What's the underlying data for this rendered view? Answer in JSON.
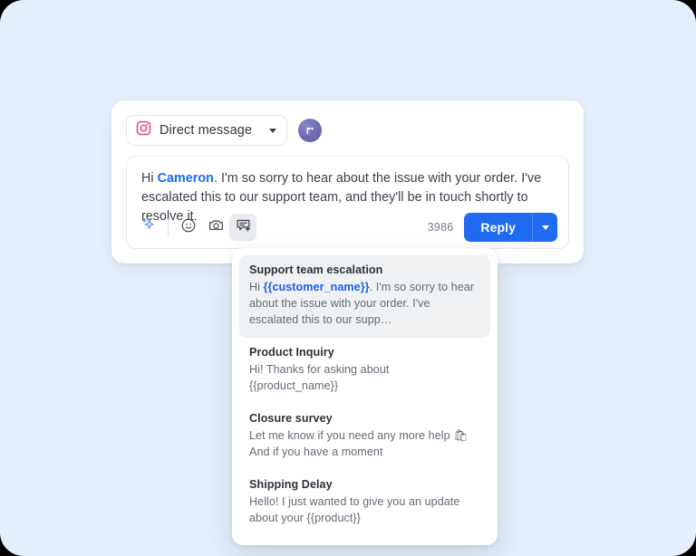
{
  "theme": {
    "page_background": "#e4effc",
    "card_background": "#ffffff",
    "accent_blue": "#1f6bf2",
    "mention_blue": "#1a6bf5",
    "selected_row": "#f0f1f3"
  },
  "composer": {
    "channel_select": {
      "icon": "instagram-icon",
      "label": "Direct message",
      "chevron": "chevron-down-icon"
    },
    "avatar": {
      "name": "user-avatar",
      "glyph": "r"
    },
    "message": {
      "greeting": "Hi ",
      "mention": "Cameron",
      "body": ". I'm so sorry to hear about the issue with your order. I've escalated this to our support team, and they'll be in touch shortly to resolve it."
    },
    "toolbar": {
      "ai_icon": "sparkle-ai-icon",
      "emoji_icon": "emoji-smiley-icon",
      "image_icon": "camera-icon",
      "snippet_icon": "message-add-icon",
      "char_count": "3986",
      "reply_label": "Reply",
      "reply_caret": "chevron-down-icon"
    }
  },
  "snippets": {
    "items": [
      {
        "title": "Support team escalation",
        "prefix": "Hi ",
        "variable": "{{customer_name}}",
        "suffix": ". I'm so sorry to hear about the issue with your order. I've escalated this to our supp…",
        "selected": true
      },
      {
        "title": "Product Inquiry",
        "prefix": "Hi! Thanks for asking about {{product_name}}",
        "variable": "",
        "suffix": "",
        "selected": false
      },
      {
        "title": "Closure survey",
        "prefix": "Let me know if you need any more help 🛍 And if you have a moment",
        "variable": "",
        "suffix": "",
        "selected": false
      },
      {
        "title": "Shipping Delay",
        "prefix": "Hello! I just wanted to give you an update about your {{product}}",
        "variable": "",
        "suffix": "",
        "selected": false
      }
    ]
  }
}
